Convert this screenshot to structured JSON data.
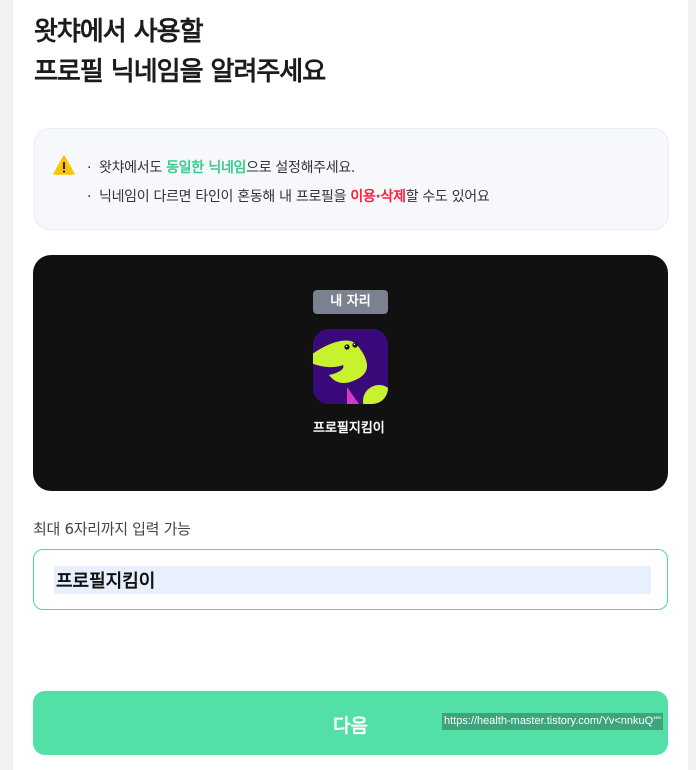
{
  "title": {
    "line1": "왓챠에서 사용할",
    "line2": "프로필 닉네임을 알려주세요"
  },
  "notice": {
    "icon": "warning-icon",
    "bullet": "·",
    "line1": {
      "before": "왓챠에서도 ",
      "highlight": "동일한 닉네임",
      "after": "으로 설정해주세요."
    },
    "line2": {
      "before": "닉네임이 다르면 타인이 혼동해 내 프로필을 ",
      "highlight": "이용·삭제",
      "after": "할 수도 있어요"
    },
    "colors": {
      "green": "#3ccb8b",
      "red": "#ff1f3d"
    }
  },
  "preview": {
    "badge": "내 자리",
    "profile_name": "프로필지킴이",
    "avatar_icon": "profile-character-icon"
  },
  "form": {
    "hint": "최대 6자리까지 입력 가능",
    "nickname_value": "프로필지킴이"
  },
  "next_button": {
    "label": "다음"
  },
  "watermark": "https://health-master.tistory.com/Yv<nnkuQ\"\"",
  "colors": {
    "accent": "#52e0a6",
    "preview_bg": "#111111"
  }
}
